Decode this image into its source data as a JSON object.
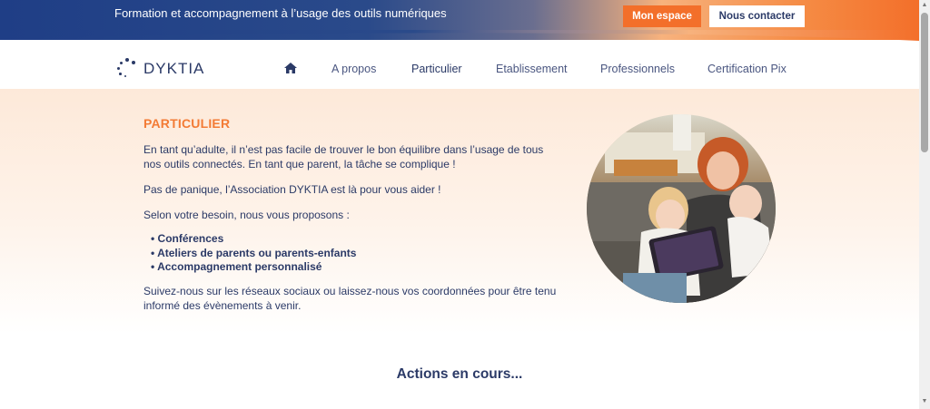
{
  "topbar": {
    "tagline": "Formation et accompagnement à l’usage des outils numériques",
    "btn_espace": "Mon espace",
    "btn_contact": "Nous contacter"
  },
  "logo": {
    "text": "DYKTIA"
  },
  "nav": {
    "home_icon": "home-icon",
    "items": [
      "A propos",
      "Particulier",
      "Etablissement",
      "Professionnels",
      "Certification Pix"
    ],
    "active": "Particulier"
  },
  "main": {
    "title": "PARTICULIER",
    "p1": "En tant qu’adulte, il n’est pas facile de trouver le bon équilibre dans l’usage de tous nos outils connectés. En tant que parent, la tâche se complique !",
    "p2": "Pas de panique, l’Association DYKTIA est là pour vous aider !",
    "p3": "Selon votre besoin, nous vous proposons :",
    "bullets": [
      "Conférences",
      "Ateliers de parents ou parents-enfants",
      "Accompagnement personnalisé"
    ],
    "p4": "Suivez-nous sur les réseaux sociaux ou laissez-nous vos coordonnées pour être tenu informé des évènements à venir."
  },
  "actions_title": "Actions en cours...",
  "colors": {
    "accent": "#f37b35",
    "navy": "#2b3a67"
  }
}
